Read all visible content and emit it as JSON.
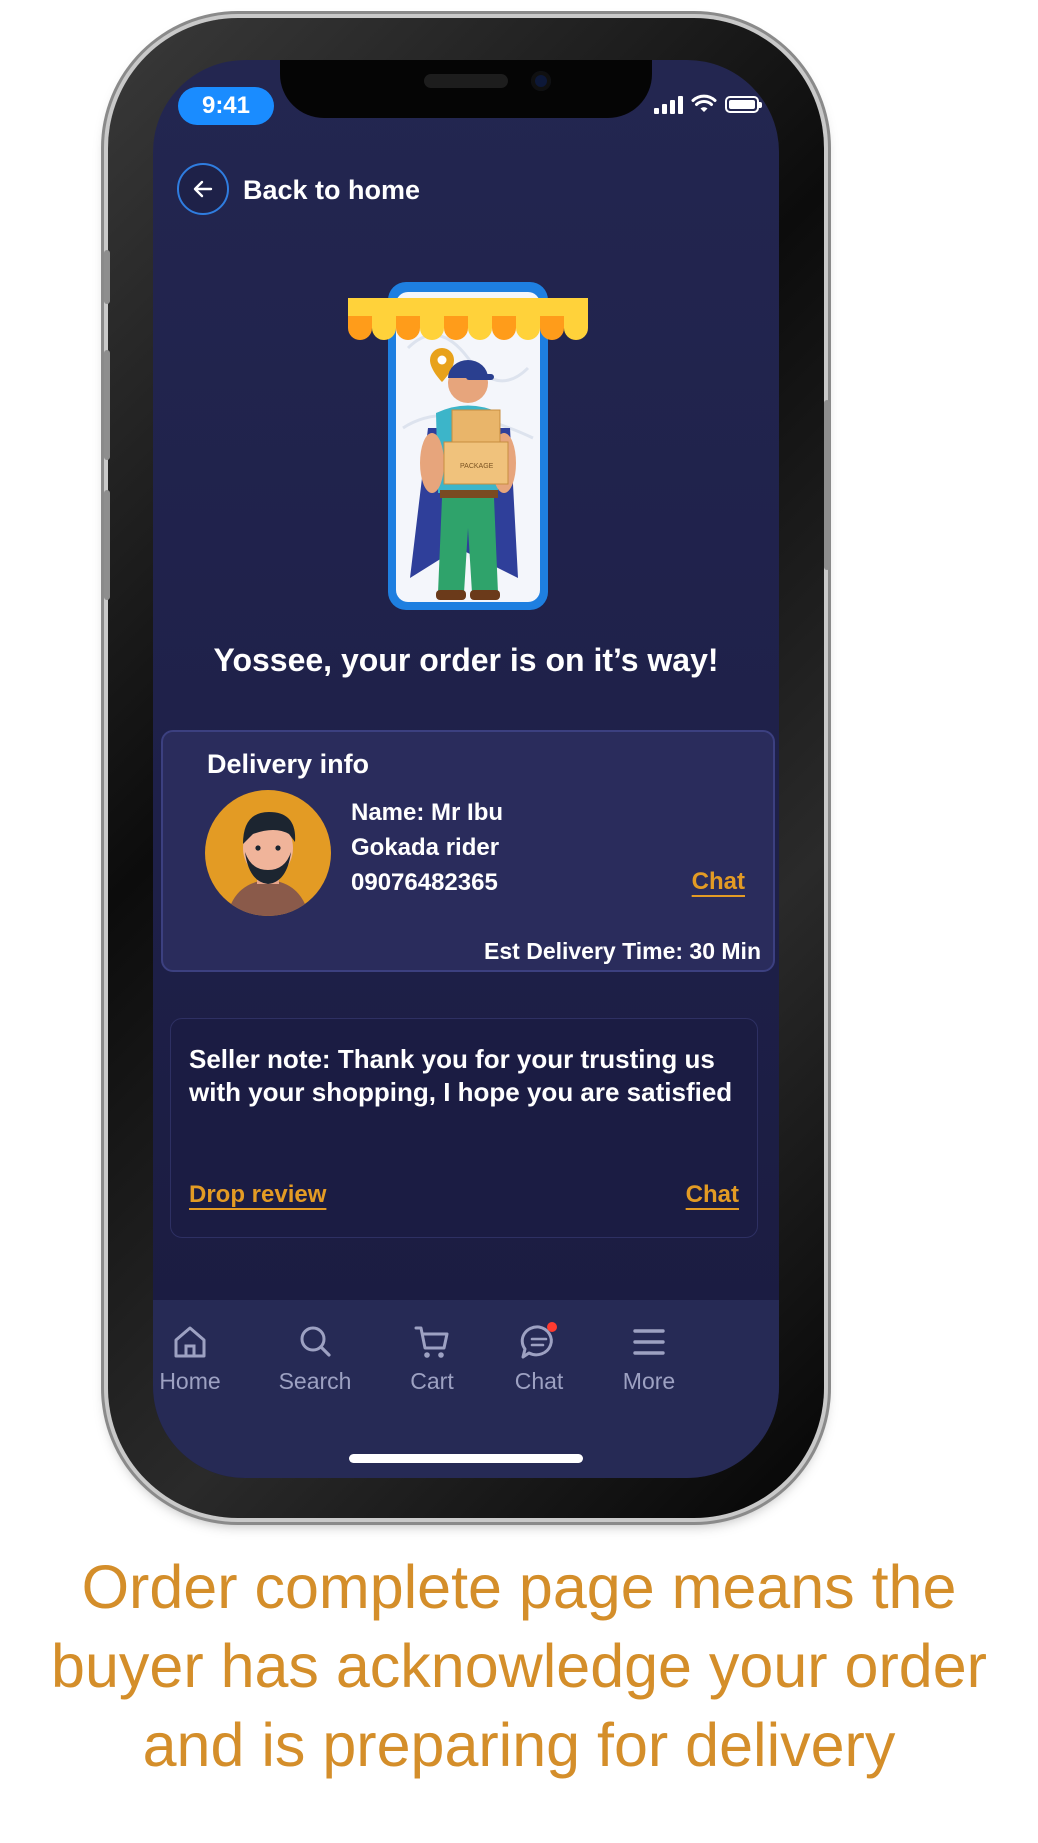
{
  "status_bar": {
    "time": "9:41"
  },
  "header": {
    "back_label": "Back to home"
  },
  "order": {
    "heading": "Yossee, your order is on it’s way!"
  },
  "delivery": {
    "title": "Delivery info",
    "rider_name": "Name: Mr Ibu",
    "rider_company": "Gokada rider",
    "rider_phone": "09076482365",
    "chat_label": "Chat",
    "est_time": "Est Delivery Time: 30 Min"
  },
  "seller_note": {
    "text": "Seller note: Thank you for your trusting us with your shopping, I hope you are satisfied",
    "review_label": "Drop review",
    "chat_label": "Chat"
  },
  "tabbar": {
    "items": [
      {
        "label": "Home",
        "icon": "home-icon"
      },
      {
        "label": "Search",
        "icon": "search-icon"
      },
      {
        "label": "Cart",
        "icon": "cart-icon"
      },
      {
        "label": "Chat",
        "icon": "chat-icon",
        "badge": true
      },
      {
        "label": "More",
        "icon": "menu-icon"
      }
    ]
  },
  "caption": "Order complete page means the buyer has acknowledge your order and is preparing for delivery",
  "colors": {
    "background": "#1e2049",
    "accent": "#e39b24",
    "time_pill": "#1a8cff",
    "badge": "#ff3b30"
  }
}
